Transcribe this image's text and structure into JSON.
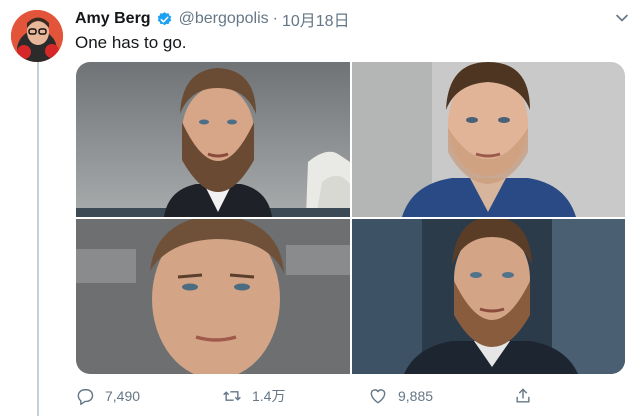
{
  "tweet": {
    "display_name": "Amy Berg",
    "handle": "@bergopolis",
    "separator": "·",
    "date": "10月18日",
    "text": "One has to go.",
    "verified": true
  },
  "media": {
    "photo_count": 4,
    "photos": [
      {
        "subject": "bearded man in suit, outdoors with sails building behind"
      },
      {
        "subject": "man in blue jacket, light background"
      },
      {
        "subject": "man with brown hair, close-up"
      },
      {
        "subject": "bearded man in dark jacket, event backdrop"
      }
    ]
  },
  "actions": {
    "reply_count": "7,490",
    "retweet_count": "1.4万",
    "like_count": "9,885"
  },
  "colors": {
    "text": "#14171a",
    "secondary": "#657786",
    "verified_blue": "#1da1f2",
    "thread_line": "#c4cfd6"
  }
}
